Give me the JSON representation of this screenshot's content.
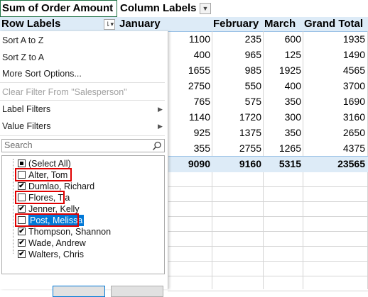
{
  "pivot": {
    "value_field": "Sum of Order Amount",
    "column_labels": "Column Labels",
    "row_labels": "Row Labels",
    "months": [
      "January",
      "February",
      "March",
      "Grand Total"
    ],
    "rows": [
      [
        "1100",
        "235",
        "600",
        "1935"
      ],
      [
        "400",
        "965",
        "125",
        "1490"
      ],
      [
        "1655",
        "985",
        "1925",
        "4565"
      ],
      [
        "2750",
        "550",
        "400",
        "3700"
      ],
      [
        "765",
        "575",
        "350",
        "1690"
      ],
      [
        "1140",
        "1720",
        "300",
        "3160"
      ],
      [
        "925",
        "1375",
        "350",
        "2650"
      ],
      [
        "355",
        "2755",
        "1265",
        "4375"
      ]
    ],
    "totals": [
      "9090",
      "9160",
      "5315",
      "23565"
    ]
  },
  "menu": {
    "sort_az": "Sort A to Z",
    "sort_za": "Sort Z to A",
    "more_sort": "More Sort Options...",
    "clear_filter": "Clear Filter From \"Salesperson\"",
    "label_filters": "Label Filters",
    "value_filters": "Value Filters",
    "search_placeholder": "Search",
    "items": [
      {
        "label": "(Select All)",
        "state": "mixed"
      },
      {
        "label": "Alter, Tom",
        "state": "unchecked"
      },
      {
        "label": "Dumlao, Richard",
        "state": "checked"
      },
      {
        "label": "Flores, Tia",
        "state": "unchecked"
      },
      {
        "label": "Jenner, Kelly",
        "state": "checked"
      },
      {
        "label": "Post, Melissa",
        "state": "unchecked"
      },
      {
        "label": "Thompson, Shannon",
        "state": "checked"
      },
      {
        "label": "Wade, Andrew",
        "state": "checked"
      },
      {
        "label": "Walters, Chris",
        "state": "checked"
      }
    ]
  },
  "colors": {
    "header_fill": "#ddebf7",
    "selection": "#0078d7",
    "highlight_border": "#e00000"
  }
}
